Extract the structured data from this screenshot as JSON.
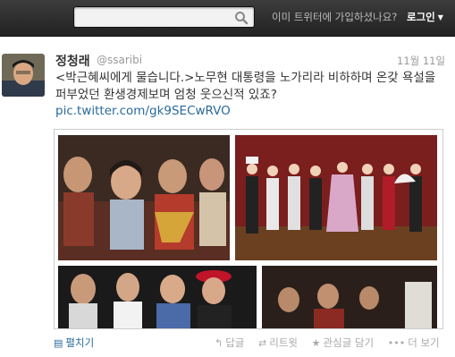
{
  "topbar": {
    "search_placeholder": "",
    "signup_prompt": "이미 트위터에 가입하셨나요?",
    "login_label": "로그인"
  },
  "tweet": {
    "author_name": "정청래",
    "handle": "@ssaribi",
    "date": "11월 11일",
    "text": "<박근혜씨에게 물습니다.>노무현 대통령을 노가리라 비하하며 온갖 욕설을 퍼부었던 환생경제보며 엄청 웃으신적 있죠?",
    "link": "pic.twitter.com/gk9SECwRVO"
  },
  "actions": {
    "expand": "펼치기",
    "reply": "답글",
    "retweet": "리트윗",
    "favorite": "관심글 담기",
    "more": "더 보기"
  },
  "colors": {
    "topbar": "#2a2a2a",
    "link": "#2a6a9a",
    "muted": "#999999"
  }
}
